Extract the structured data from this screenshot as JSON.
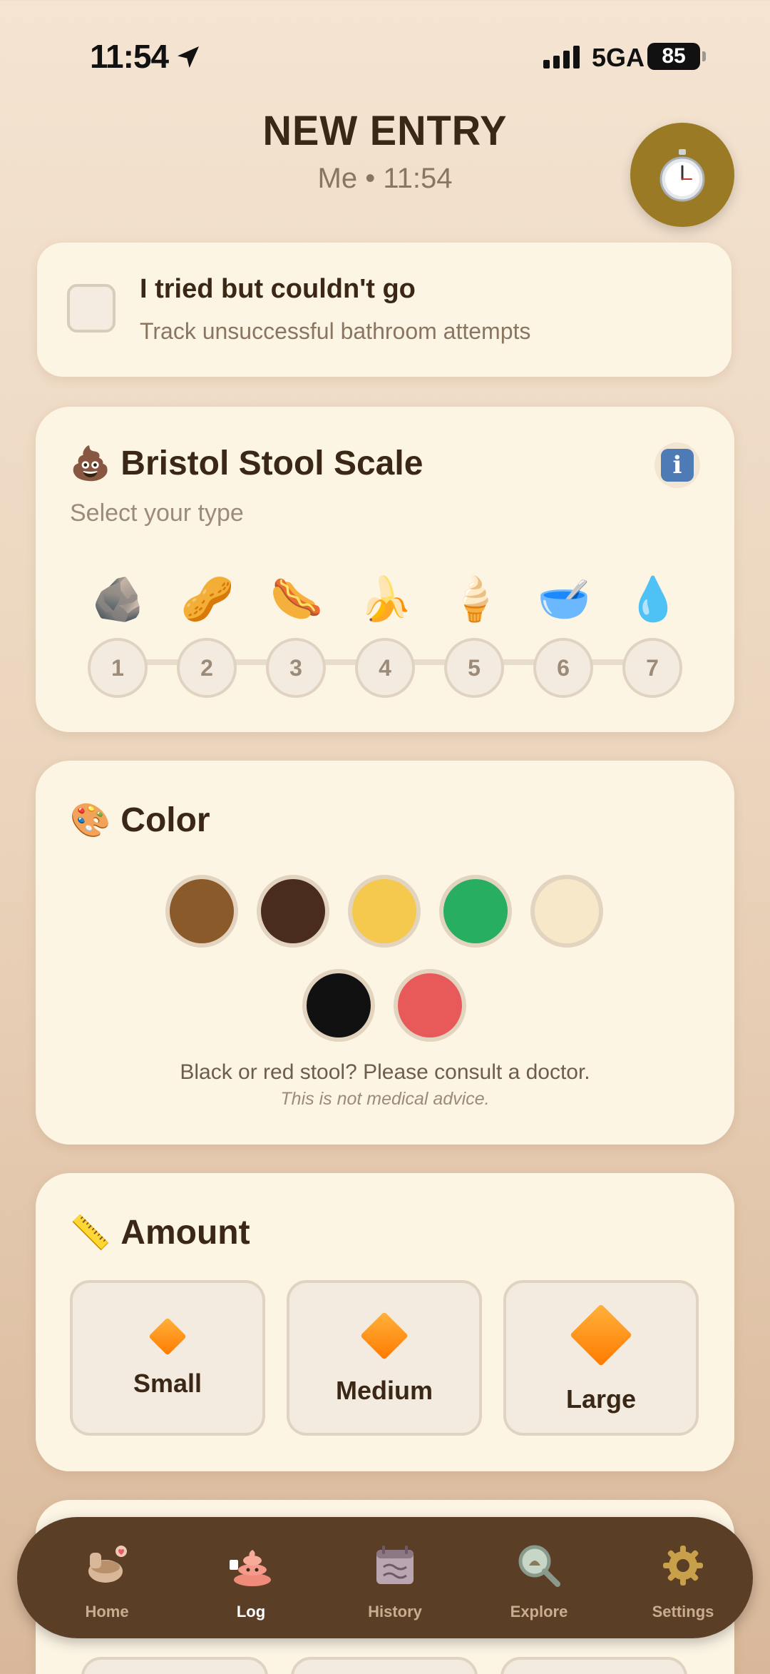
{
  "status_bar": {
    "time": "11:54",
    "network": "5GA",
    "battery": "85"
  },
  "header": {
    "title": "NEW ENTRY",
    "subtitle": "Me • 11:54"
  },
  "attempt": {
    "title": "I tried but couldn't go",
    "subtitle": "Track unsuccessful bathroom attempts"
  },
  "bristol": {
    "emoji": "💩",
    "title": "Bristol Stool Scale",
    "subtitle": "Select your type",
    "types": [
      {
        "num": "1",
        "emoji": "🪨"
      },
      {
        "num": "2",
        "emoji": "🥜"
      },
      {
        "num": "3",
        "emoji": "🌭"
      },
      {
        "num": "4",
        "emoji": "🍌"
      },
      {
        "num": "5",
        "emoji": "🍦"
      },
      {
        "num": "6",
        "emoji": "🥣"
      },
      {
        "num": "7",
        "emoji": "💧"
      }
    ]
  },
  "color": {
    "emoji": "🎨",
    "title": "Color",
    "swatches": [
      "#8b5a2b",
      "#4a2c1e",
      "#f5c94e",
      "#27ae60",
      "#f6e8c8",
      "#111111",
      "#e85a5a"
    ],
    "warning": "Black or red stool? Please consult a doctor.",
    "disclaimer": "This is not medical advice."
  },
  "amount": {
    "emoji": "📏",
    "title": "Amount",
    "options": [
      "Small",
      "Medium",
      "Large"
    ]
  },
  "tabs": [
    {
      "label": "Home",
      "icon": "potty-icon"
    },
    {
      "label": "Log",
      "icon": "poop-icon"
    },
    {
      "label": "History",
      "icon": "calendar-icon"
    },
    {
      "label": "Explore",
      "icon": "magnifier-icon"
    },
    {
      "label": "Settings",
      "icon": "gear-icon"
    }
  ],
  "active_tab": "Log",
  "colors": {
    "accent": "#9a7a24",
    "tab_bar": "#5a3e26",
    "card": "#fdf5e4"
  }
}
